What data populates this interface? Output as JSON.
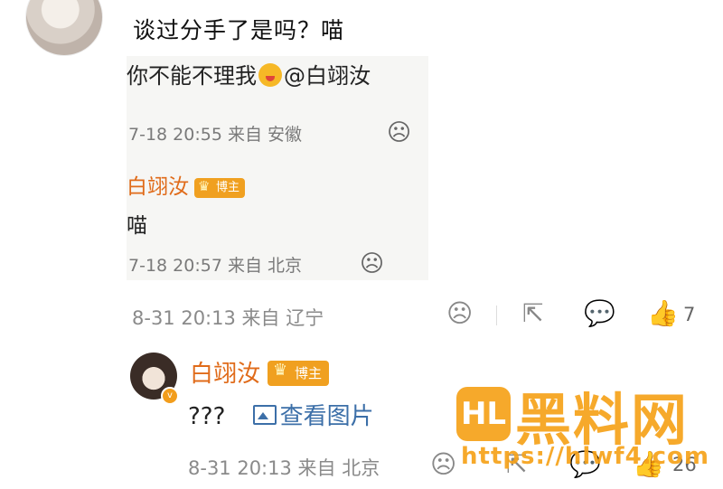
{
  "comment": {
    "text": "谈过分手了是吗？喵"
  },
  "quoted_screenshot": {
    "line1_text": "你不能不理我",
    "line1_mention": "@白翊汝",
    "meta1": "7-18 20:55 来自 安徽",
    "author": "白翊汝",
    "author_badge": "博主",
    "reply": "喵",
    "meta2": "7-18 20:57 来自 北京"
  },
  "comment_meta": {
    "time_location": "8-31 20:13 来自 辽宁",
    "like_count": "7"
  },
  "reply": {
    "author": "白翊汝",
    "author_badge": "博主",
    "text": "???",
    "view_image_label": "查看图片",
    "time_location": "8-31 20:13 来自 北京",
    "like_count": "26"
  },
  "watermark": {
    "logo_text": "HL",
    "title": "黑料网",
    "url": "https://hlwf4.com"
  },
  "icons": {
    "dislike": "sad-face-icon",
    "share": "share-icon",
    "comment": "comment-icon",
    "like": "thumbs-up-icon",
    "image": "image-icon"
  },
  "colors": {
    "author": "#e06b1a",
    "badge": "#f0a020",
    "link": "#3c6fa8",
    "meta": "#8a8a8a",
    "watermark": "#f6a21a"
  }
}
